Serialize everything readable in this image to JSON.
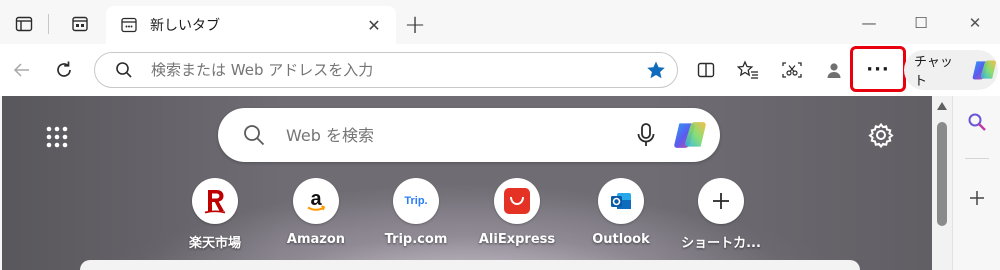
{
  "tab": {
    "title": "新しいタブ",
    "close_glyph": "✕"
  },
  "titlebar": {
    "new_tab_glyph": "+",
    "minimize_glyph": "—",
    "maximize_glyph": "☐",
    "close_glyph": "✕"
  },
  "navbar": {
    "address_placeholder": "検索または Web アドレスを入力",
    "more_glyph": "···",
    "chat_label": "チャット"
  },
  "newtab": {
    "search_placeholder": "Web を検索",
    "quick_links": [
      {
        "label": "楽天市場",
        "icon": "rakuten-icon"
      },
      {
        "label": "Amazon",
        "icon": "amazon-icon"
      },
      {
        "label": "Trip.com",
        "icon": "tripcom-icon",
        "logo_text": "Trip."
      },
      {
        "label": "AliExpress",
        "icon": "aliexpress-icon"
      },
      {
        "label": "Outlook",
        "icon": "outlook-icon"
      },
      {
        "label": "ショートカ...",
        "icon": "plus-icon"
      }
    ]
  },
  "colors": {
    "accent_blue": "#0f6cbd",
    "highlight_red": "#e8000e",
    "rakuten_red": "#bf0000",
    "aliexpress_red": "#e43225",
    "outlook_blue": "#0f6cbd"
  }
}
